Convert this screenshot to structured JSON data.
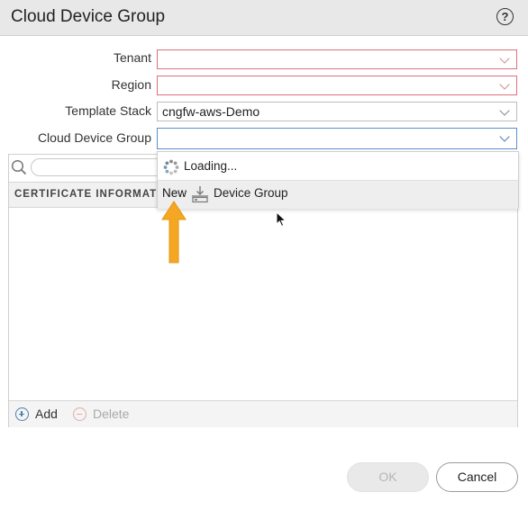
{
  "dialog": {
    "title": "Cloud Device Group",
    "help_symbol": "?"
  },
  "form": {
    "fields": [
      {
        "label": "Tenant",
        "value": "",
        "state": "error"
      },
      {
        "label": "Region",
        "value": "",
        "state": "error"
      },
      {
        "label": "Template Stack",
        "value": "cngfw-aws-Demo",
        "state": "normal"
      },
      {
        "label": "Cloud Device Group",
        "value": "",
        "state": "focused"
      }
    ]
  },
  "dropdown": {
    "loading_text": "Loading...",
    "new_item_prefix": "New",
    "new_item_label": "Device Group",
    "spinner_icon": "loading-spinner-icon",
    "device_group_icon": "device-group-icon"
  },
  "table": {
    "search_value": "",
    "column_header": "CERTIFICATE INFORMATI",
    "rows": [],
    "add_label": "Add",
    "delete_label": "Delete"
  },
  "footer": {
    "ok_label": "OK",
    "ok_enabled": false,
    "cancel_label": "Cancel"
  },
  "colors": {
    "error_border": "#e0707a",
    "focus_border": "#5b8fcb",
    "annotation_arrow": "#f5a623",
    "add_icon": "#4f7fb0",
    "delete_icon": "#e7a8aa"
  }
}
